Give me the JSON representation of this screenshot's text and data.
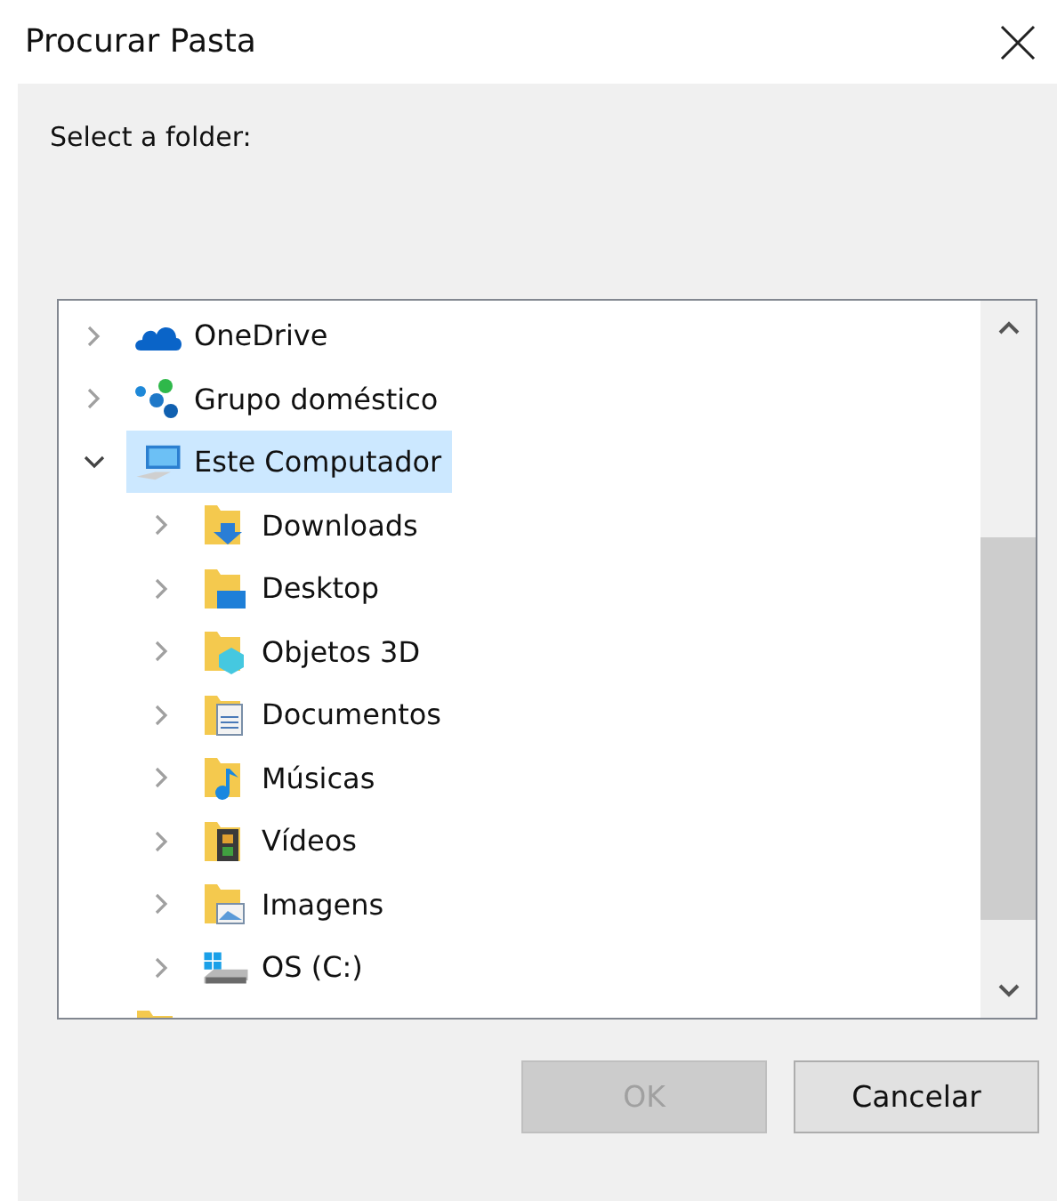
{
  "window": {
    "title": "Procurar Pasta"
  },
  "prompt": "Select a folder:",
  "tree": [
    {
      "label": "OneDrive",
      "kind": "cloud",
      "expanded": false,
      "selected": false
    },
    {
      "label": "Grupo doméstico",
      "kind": "homegroup",
      "expanded": false,
      "selected": false
    },
    {
      "label": "Este Computador",
      "kind": "computer",
      "expanded": true,
      "selected": true,
      "children": [
        {
          "label": "Downloads",
          "kind": "downloads",
          "expanded": false,
          "selected": false
        },
        {
          "label": "Desktop",
          "kind": "desktop",
          "expanded": false,
          "selected": false
        },
        {
          "label": "Objetos 3D",
          "kind": "objects3d",
          "expanded": false,
          "selected": false
        },
        {
          "label": "Documentos",
          "kind": "documents",
          "expanded": false,
          "selected": false
        },
        {
          "label": "Músicas",
          "kind": "music",
          "expanded": false,
          "selected": false
        },
        {
          "label": "Vídeos",
          "kind": "videos",
          "expanded": false,
          "selected": false
        },
        {
          "label": "Imagens",
          "kind": "pictures",
          "expanded": false,
          "selected": false
        },
        {
          "label": "OS (C:)",
          "kind": "drive",
          "expanded": false,
          "selected": false
        }
      ]
    },
    {
      "kind": "folder"
    }
  ],
  "buttons": [
    {
      "label": "OK",
      "disabled": true
    },
    {
      "label": "Cancelar",
      "disabled": false
    }
  ]
}
